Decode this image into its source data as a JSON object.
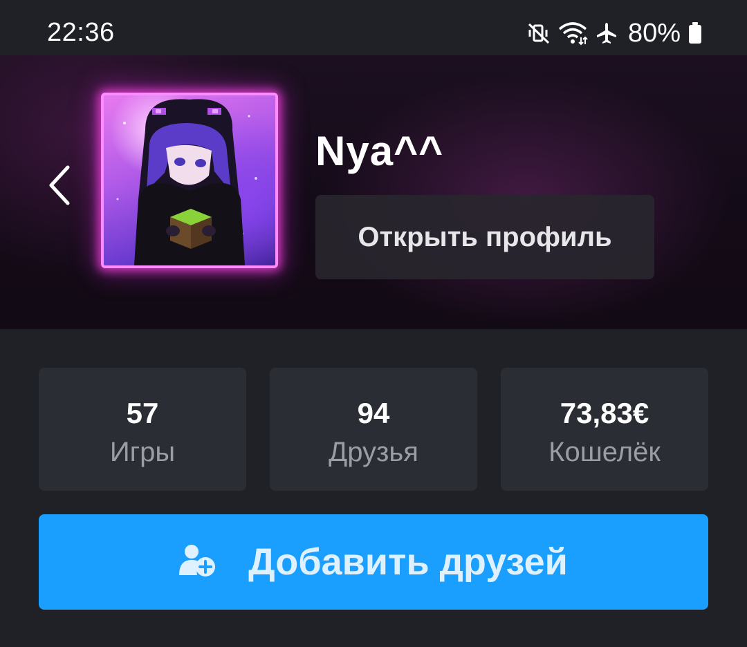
{
  "status_bar": {
    "time": "22:36",
    "battery": "80%",
    "icons": [
      "mute-vibrate-icon",
      "wifi-icon",
      "airplane-icon",
      "battery-icon"
    ]
  },
  "profile": {
    "username": "Nya^^",
    "open_profile_label": "Открыть профиль",
    "avatar": "avatar-image"
  },
  "stats": [
    {
      "value": "57",
      "label": "Игры"
    },
    {
      "value": "94",
      "label": "Друзья"
    },
    {
      "value": "73,83€",
      "label": "Кошелёк"
    }
  ],
  "actions": {
    "add_friends_label": "Добавить друзей",
    "add_friends_icon": "add-user-icon"
  },
  "colors": {
    "background": "#1f2126",
    "card": "#2a2d33",
    "accent": "#1a9fff",
    "avatar_glow": "#ff8cff",
    "muted_text": "#9a9da5"
  }
}
